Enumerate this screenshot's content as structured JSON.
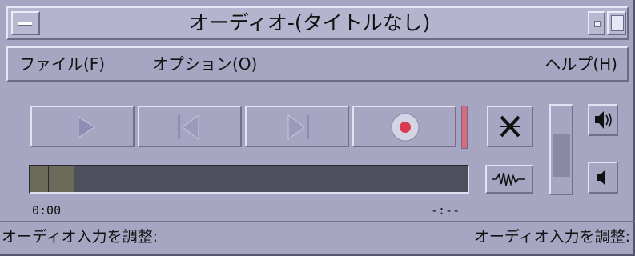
{
  "window": {
    "title": "オーディオ-(タイトルなし)"
  },
  "menubar": {
    "items": [
      {
        "label": "ファイル(F)"
      },
      {
        "label": "オプション(O)"
      },
      {
        "label": "ヘルプ(H)"
      }
    ]
  },
  "transport": {
    "buttons": [
      {
        "name": "play",
        "icon": "play-icon"
      },
      {
        "name": "previous",
        "icon": "skip-back-icon"
      },
      {
        "name": "next",
        "icon": "skip-forward-icon"
      },
      {
        "name": "record",
        "icon": "record-icon"
      }
    ],
    "record_level_color": "#d66c7c"
  },
  "progress": {
    "value": 0.1,
    "time_start": "0:00",
    "time_end": "-:--"
  },
  "volume": {
    "level": 0.45
  },
  "footer": {
    "left_text": "オーディオ入力を調整:",
    "right_text": "オーディオ入力を調整:"
  },
  "icons": [
    "window-menu-icon",
    "minimize-icon",
    "maximize-icon",
    "stop-icon",
    "waveform-icon",
    "speaker-loud-icon",
    "speaker-soft-icon"
  ]
}
